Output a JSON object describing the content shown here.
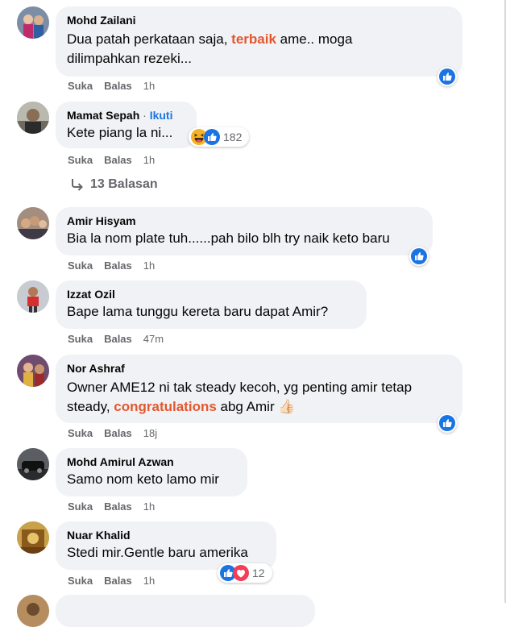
{
  "actions": {
    "like": "Suka",
    "reply": "Balas"
  },
  "comments": [
    {
      "name": "Mohd Zailani",
      "text_before": "Dua patah perkataan saja, ",
      "highlight": "terbaik",
      "text_after": " ame.. moga",
      "line2": "dilimpahkan rezeki...",
      "time": "1h"
    },
    {
      "name": "Mamat Sepah",
      "follow_sep": " · ",
      "follow": "Ikuti",
      "text": "Kete piang la ni...",
      "time": "1h",
      "reaction_count": "182"
    },
    {
      "name": "Amir Hisyam",
      "text": "Bia la nom plate tuh......pah bilo blh try naik keto baru",
      "time": "1h"
    },
    {
      "name": "Izzat Ozil",
      "text": "Bape lama tunggu kereta baru dapat Amir?",
      "time": "47m"
    },
    {
      "name": "Nor Ashraf",
      "line1": "Owner AME12 ni tak steady kecoh, yg penting amir tetap",
      "line2_before": "steady, ",
      "highlight": "congratulations",
      "line2_after": " abg Amir ",
      "emoji": "👍🏻",
      "time": "18j"
    },
    {
      "name": "Mohd Amirul Azwan",
      "text": "Samo nom keto lamo mir",
      "time": "1h"
    },
    {
      "name": "Nuar Khalid",
      "text": "Stedi mir.Gentle baru amerika",
      "time": "1h",
      "reaction_count": "12"
    }
  ],
  "replies_label": "13 Balasan",
  "colors": {
    "bubble": "#f0f2f5",
    "like_blue": "#1b74e4",
    "highlight": "#e4572e",
    "love_red": "#f33e58",
    "haha_yellow": "#f7b125"
  },
  "icons": [
    "like-reaction-icon",
    "haha-reaction-icon",
    "love-reaction-icon",
    "reply-arrow-icon"
  ]
}
